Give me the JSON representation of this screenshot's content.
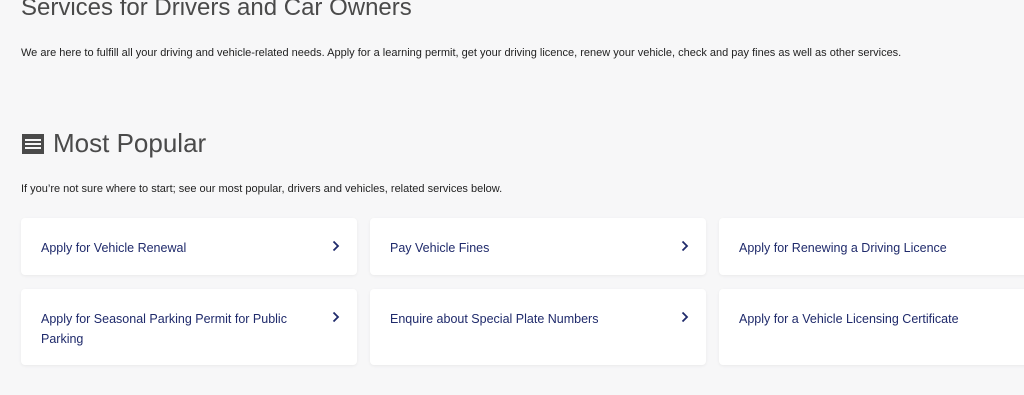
{
  "page": {
    "title": "Services for Drivers and Car Owners",
    "intro": "We are here to fulfill all your driving and vehicle-related needs. Apply for a learning permit, get your driving licence, renew your vehicle, check and pay fines as well as other services."
  },
  "popular": {
    "heading": "Most Popular",
    "icon": "list-icon",
    "description": "If you’re not sure where to start; see our most popular, drivers and vehicles, related services below.",
    "cards": [
      {
        "label": "Apply for Vehicle Renewal",
        "icon": "chevron-right-icon"
      },
      {
        "label": "Pay Vehicle Fines",
        "icon": "chevron-right-icon"
      },
      {
        "label": "Apply for Renewing a Driving Licence",
        "icon": "chevron-right-icon"
      },
      {
        "label": "Apply for Seasonal Parking Permit for Public Parking",
        "icon": "chevron-right-icon"
      },
      {
        "label": "Enquire about Special Plate Numbers",
        "icon": "chevron-right-icon"
      },
      {
        "label": "Apply for a Vehicle Licensing Certificate",
        "icon": "chevron-right-icon"
      }
    ]
  },
  "colors": {
    "background": "#f7f7f8",
    "card": "#ffffff",
    "link_text": "#1f2a6b",
    "heading": "#4a4a4a"
  }
}
